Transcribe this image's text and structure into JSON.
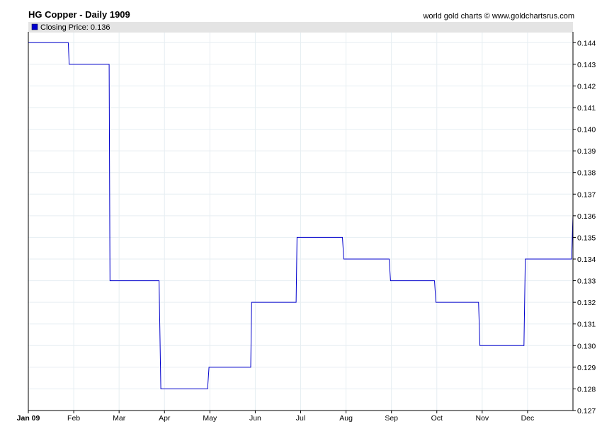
{
  "header": {
    "title": "HG Copper - Daily 1909",
    "credit": "world gold charts © www.goldchartsrus.com"
  },
  "legend": {
    "label": "Closing Price: 0.136",
    "color": "#0000cc"
  },
  "chart_data": {
    "type": "line",
    "title": "HG Copper - Daily 1909",
    "xlabel": "",
    "ylabel": "",
    "x_type": "month-index",
    "x_range": [
      0,
      12
    ],
    "ylim": [
      0.127,
      0.1445
    ],
    "grid": true,
    "legend_position": "top-left",
    "line_style": "step",
    "series": [
      {
        "name": "Closing Price: 0.136",
        "color": "#0000cc",
        "points": [
          [
            0.0,
            0.144
          ],
          [
            0.88,
            0.144
          ],
          [
            0.9,
            0.143
          ],
          [
            1.78,
            0.143
          ],
          [
            1.8,
            0.133
          ],
          [
            2.88,
            0.133
          ],
          [
            2.92,
            0.128
          ],
          [
            3.95,
            0.128
          ],
          [
            3.98,
            0.129
          ],
          [
            4.9,
            0.129
          ],
          [
            4.92,
            0.132
          ],
          [
            5.9,
            0.132
          ],
          [
            5.92,
            0.135
          ],
          [
            6.92,
            0.135
          ],
          [
            6.95,
            0.134
          ],
          [
            7.95,
            0.134
          ],
          [
            7.98,
            0.133
          ],
          [
            8.95,
            0.133
          ],
          [
            8.98,
            0.132
          ],
          [
            9.92,
            0.132
          ],
          [
            9.95,
            0.13
          ],
          [
            10.92,
            0.13
          ],
          [
            10.95,
            0.134
          ],
          [
            11.97,
            0.134
          ],
          [
            12.0,
            0.136
          ]
        ]
      }
    ],
    "y_ticks": [
      "0.144",
      "0.143",
      "0.142",
      "0.141",
      "0.140",
      "0.139",
      "0.138",
      "0.137",
      "0.136",
      "0.135",
      "0.134",
      "0.133",
      "0.132",
      "0.131",
      "0.130",
      "0.129",
      "0.128",
      "0.127"
    ],
    "x_ticks": [
      "Jan 09",
      "Feb",
      "Mar",
      "Apr",
      "May",
      "Jun",
      "Jul",
      "Aug",
      "Sep",
      "Oct",
      "Nov",
      "Dec"
    ]
  }
}
